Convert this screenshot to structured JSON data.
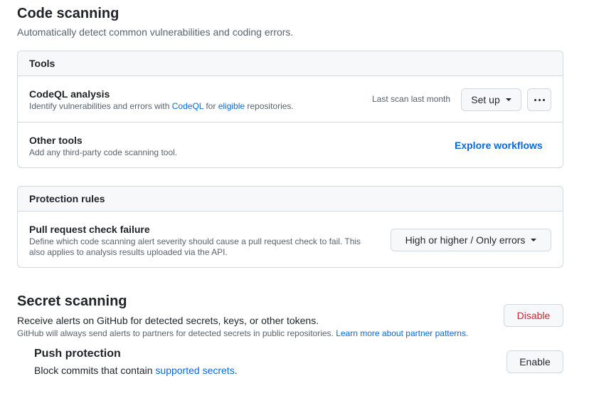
{
  "code_scanning": {
    "title": "Code scanning",
    "description": "Automatically detect common vulnerabilities and coding errors."
  },
  "tools": {
    "header": "Tools",
    "codeql": {
      "title": "CodeQL analysis",
      "desc_prefix": "Identify vulnerabilities and errors with ",
      "desc_link1": "CodeQL",
      "desc_mid": " for ",
      "desc_link2": "eligible",
      "desc_suffix": " repositories.",
      "last_scan": "Last scan last month",
      "setup_label": "Set up",
      "more_icon": "kebab-horizontal-icon"
    },
    "other": {
      "title": "Other tools",
      "desc": "Add any third-party code scanning tool.",
      "explore_label": "Explore workflows"
    }
  },
  "protection": {
    "header": "Protection rules",
    "pr_check": {
      "title": "Pull request check failure",
      "desc_line1": "Define which code scanning alert severity should cause a pull request check to fail. This",
      "desc_line2": "also applies to analysis results uploaded via the API.",
      "select_value": "High or higher / Only errors"
    }
  },
  "secret_scanning": {
    "title": "Secret scanning",
    "description": "Receive alerts on GitHub for detected secrets, keys, or other tokens.",
    "note_prefix": "GitHub will always send alerts to partners for detected secrets in public repositories. ",
    "note_link": "Learn more about partner patterns",
    "note_suffix": ".",
    "disable_label": "Disable"
  },
  "push_protection": {
    "title": "Push protection",
    "desc_prefix": "Block commits that contain ",
    "desc_link": "supported secrets",
    "desc_suffix": ".",
    "enable_label": "Enable"
  },
  "colors": {
    "link": "#0969da",
    "danger": "#d1242f",
    "border": "#d1d9e0",
    "muted": "#59636e"
  }
}
